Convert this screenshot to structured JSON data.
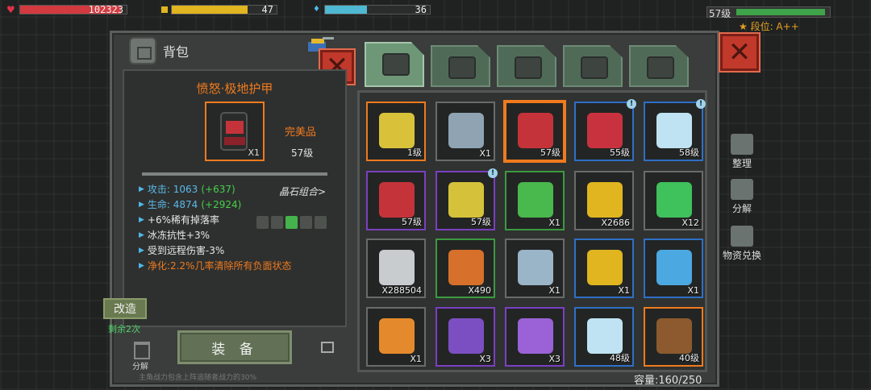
{
  "hud": {
    "hp_value": "102323",
    "hp_fill": 0.95,
    "energy_value": "47",
    "energy_fill": 0.72,
    "shield_value": "36",
    "shield_fill": 0.4,
    "level_label": "57级",
    "level_fill": 0.95,
    "rank_label": "段位: A++"
  },
  "bag": {
    "title": "背包",
    "close_icon": "close-icon"
  },
  "detail": {
    "item_name": "愤怒·极地护甲",
    "item_qty": "X1",
    "quality": "完美品",
    "level": "57级",
    "gem_combo": "晶石组合>",
    "stats": [
      {
        "label": "攻击: 1063",
        "bonus": "(+637)"
      },
      {
        "label": "生命: 4874",
        "bonus": "(+2924)"
      },
      {
        "label": "+6%稀有掉落率"
      },
      {
        "label": "冰冻抗性+3%"
      },
      {
        "label": "受到远程伤害-3%"
      },
      {
        "label": "净化:2.2%几率清除所有负面状态"
      }
    ],
    "modify_button": "改造",
    "remaining": "剩余2次",
    "dismantle_label": "分解",
    "equip_button": "装 备",
    "footnote": "主角战力包含上阵追随者战力的30%"
  },
  "tabs": [
    {
      "name": "backpack",
      "icon": "backpack-icon",
      "active": true
    },
    {
      "name": "medkit",
      "icon": "medkit-icon",
      "active": false
    },
    {
      "name": "material",
      "icon": "material-icon",
      "active": false
    },
    {
      "name": "weapon",
      "icon": "gun-icon",
      "active": false
    },
    {
      "name": "misc",
      "icon": "wrench-icon",
      "active": false
    }
  ],
  "grid": {
    "items": [
      {
        "icon": "chip-icon",
        "count": "1级",
        "quality": "legend",
        "color": "#d9c23a"
      },
      {
        "icon": "exp-badge-icon",
        "count": "X1",
        "quality": "common",
        "color": "#8fa3b2"
      },
      {
        "icon": "backpack-icon",
        "count": "57级",
        "quality": "legend",
        "color": "#c5333a",
        "selected": true
      },
      {
        "icon": "red-jacket-icon",
        "count": "55级",
        "quality": "rare",
        "color": "#c8323e",
        "new": "!"
      },
      {
        "icon": "blade-icon",
        "count": "58级",
        "quality": "rare",
        "color": "#bfe3f2",
        "new": "!"
      },
      {
        "icon": "backpack-icon",
        "count": "57级",
        "quality": "epic",
        "color": "#c5333a"
      },
      {
        "icon": "blaster-icon",
        "count": "57级",
        "quality": "epic",
        "color": "#d6c23a",
        "new": "!"
      },
      {
        "icon": "sale-voucher-icon",
        "count": "X1",
        "quality": "uncommon",
        "color": "#49b84d"
      },
      {
        "icon": "gold-coin-icon",
        "count": "X2686",
        "quality": "common",
        "color": "#e0b520"
      },
      {
        "icon": "cocktail-icon",
        "count": "X12",
        "quality": "common",
        "color": "#3fc15b"
      },
      {
        "icon": "silver-coin-icon",
        "count": "X288504",
        "quality": "common",
        "color": "#c8cccf"
      },
      {
        "icon": "medal-icon",
        "count": "X490",
        "quality": "uncommon",
        "color": "#d6702a"
      },
      {
        "icon": "map-icon",
        "count": "X1",
        "quality": "common",
        "color": "#9ab4c8"
      },
      {
        "icon": "exp-badge-icon",
        "count": "X1",
        "quality": "rare",
        "color": "#e0b520"
      },
      {
        "icon": "music-disc-icon",
        "count": "X1",
        "quality": "rare",
        "color": "#4ba8e0"
      },
      {
        "icon": "supply-crate-icon",
        "count": "X1",
        "quality": "common",
        "color": "#e58a2c"
      },
      {
        "icon": "purple-crate-icon",
        "count": "X3",
        "quality": "epic",
        "color": "#7b4fc2"
      },
      {
        "icon": "purple-chest-icon",
        "count": "X3",
        "quality": "epic",
        "color": "#9a62d6"
      },
      {
        "icon": "blade-icon",
        "count": "48级",
        "quality": "rare",
        "color": "#bfe3f2"
      },
      {
        "icon": "rifle-icon",
        "count": "40级",
        "quality": "legend",
        "color": "#8c5a2e"
      }
    ],
    "capacity": "容量:160/250"
  },
  "side_menu": [
    {
      "label": "整理",
      "icon": "sort-icon"
    },
    {
      "label": "分解",
      "icon": "dismantle-icon"
    },
    {
      "label": "物资兑换",
      "icon": "exchange-icon"
    }
  ],
  "colors": {
    "legend": "#f07a1e",
    "epic": "#7b3fc1",
    "rare": "#2f6fc7",
    "uncommon": "#3c9a40"
  }
}
